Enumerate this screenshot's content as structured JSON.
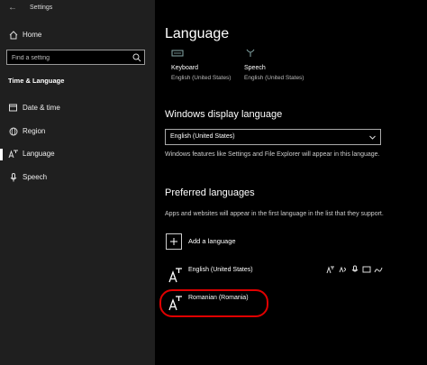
{
  "window": {
    "title": "Settings",
    "back_icon": "back-arrow-icon"
  },
  "sidebar": {
    "home": {
      "label": "Home",
      "icon": "home-icon"
    },
    "search": {
      "placeholder": "Find a setting",
      "icon": "search-icon"
    },
    "section": "Time & Language",
    "items": [
      {
        "label": "Date & time",
        "icon": "calendar-clock-icon"
      },
      {
        "label": "Region",
        "icon": "globe-icon"
      },
      {
        "label": "Language",
        "icon": "language-icon",
        "selected": true
      },
      {
        "label": "Speech",
        "icon": "microphone-icon"
      }
    ]
  },
  "main": {
    "title": "Language",
    "tiles": [
      {
        "name": "Keyboard",
        "value": "English (United States)",
        "icon": "keyboard-icon"
      },
      {
        "name": "Speech",
        "value": "English (United States)",
        "icon": "microphone-icon"
      }
    ],
    "display_language": {
      "heading": "Windows display language",
      "selected": "English (United States)",
      "description": "Windows features like Settings and File Explorer will appear in this language."
    },
    "preferred": {
      "heading": "Preferred languages",
      "description": "Apps and websites will appear in the first language in the list that they support.",
      "add_label": "Add a language",
      "languages": [
        {
          "name": "English (United States)",
          "features": [
            "display-language-icon",
            "speech-icon",
            "microphone-icon",
            "keyboard-icon",
            "handwriting-icon"
          ]
        },
        {
          "name": "Romanian (Romania)"
        }
      ]
    }
  },
  "colors": {
    "sidebar_bg": "#1f1f1f",
    "main_bg": "#000000",
    "highlight": "#e00000"
  }
}
